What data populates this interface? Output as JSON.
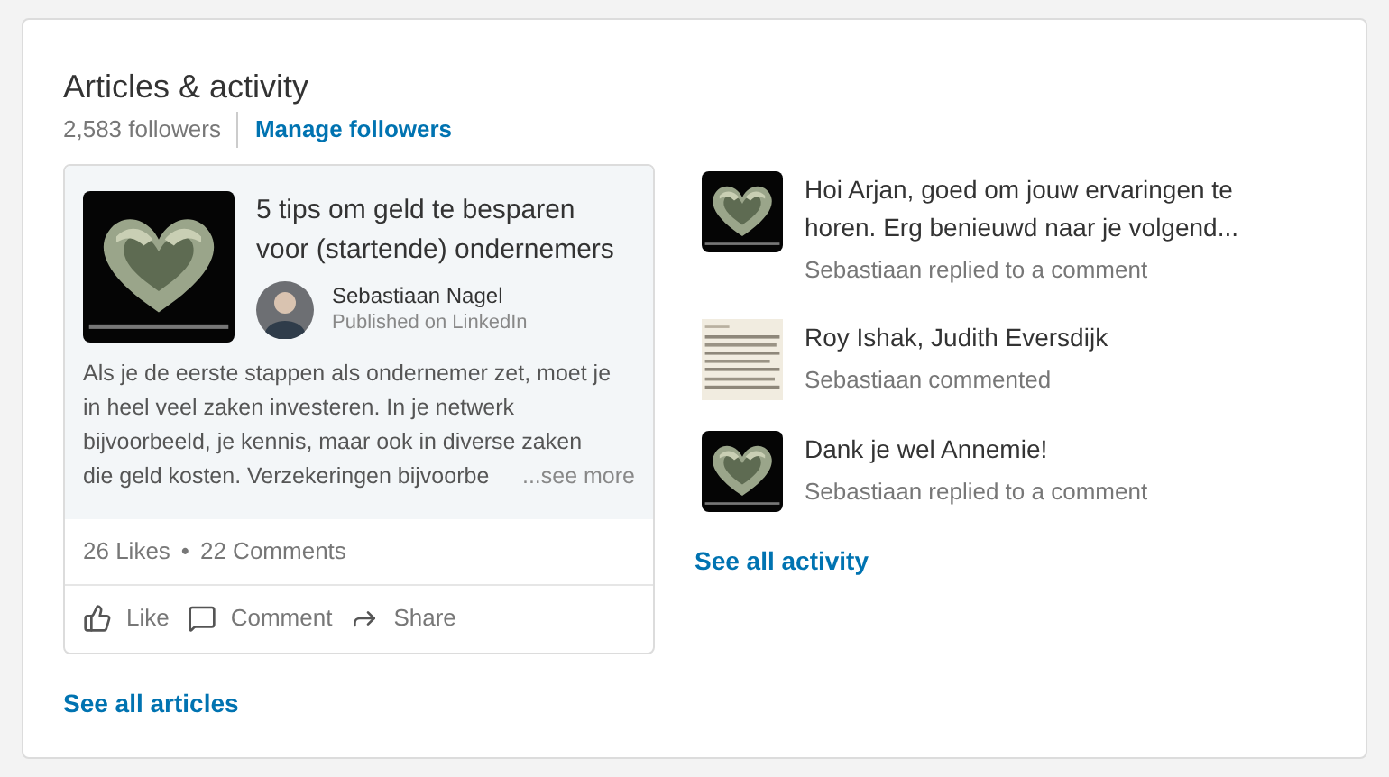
{
  "section": {
    "title": "Articles & activity",
    "followers": "2,583 followers",
    "manage_link": "Manage followers"
  },
  "article": {
    "title": "5 tips om geld te besparen voor (startende) ondernemers",
    "author": "Sebastiaan Nagel",
    "published": "Published on LinkedIn",
    "excerpt_lines": [
      "Als je de eerste stappen als ondernemer zet, moet je",
      "in heel veel zaken investeren. In je netwerk",
      "bijvoorbeeld, je kennis, maar ook in diverse zaken",
      "die geld kosten. Verzekeringen bijvoorbe"
    ],
    "see_more": "...see more",
    "likes": "26 Likes",
    "separator": "•",
    "comments": "22 Comments",
    "actions": [
      {
        "kind": "like",
        "label": "Like"
      },
      {
        "kind": "comment",
        "label": "Comment"
      },
      {
        "kind": "share",
        "label": "Share"
      }
    ]
  },
  "see_all_articles": "See all articles",
  "activity": [
    {
      "kind": "picture",
      "text": "Hoi Arjan, goed om jouw ervaringen te horen. Erg benieuwd naar je volgend...",
      "meta": "Sebastiaan replied to a comment"
    },
    {
      "kind": "picture",
      "text": "Roy Ishak, Judith Eversdijk",
      "meta": "Sebastiaan commented"
    },
    {
      "kind": "picture",
      "text": "Dank je wel Annemie!",
      "meta": "Sebastiaan replied to a comment"
    }
  ],
  "see_all_activity": "See all activity"
}
